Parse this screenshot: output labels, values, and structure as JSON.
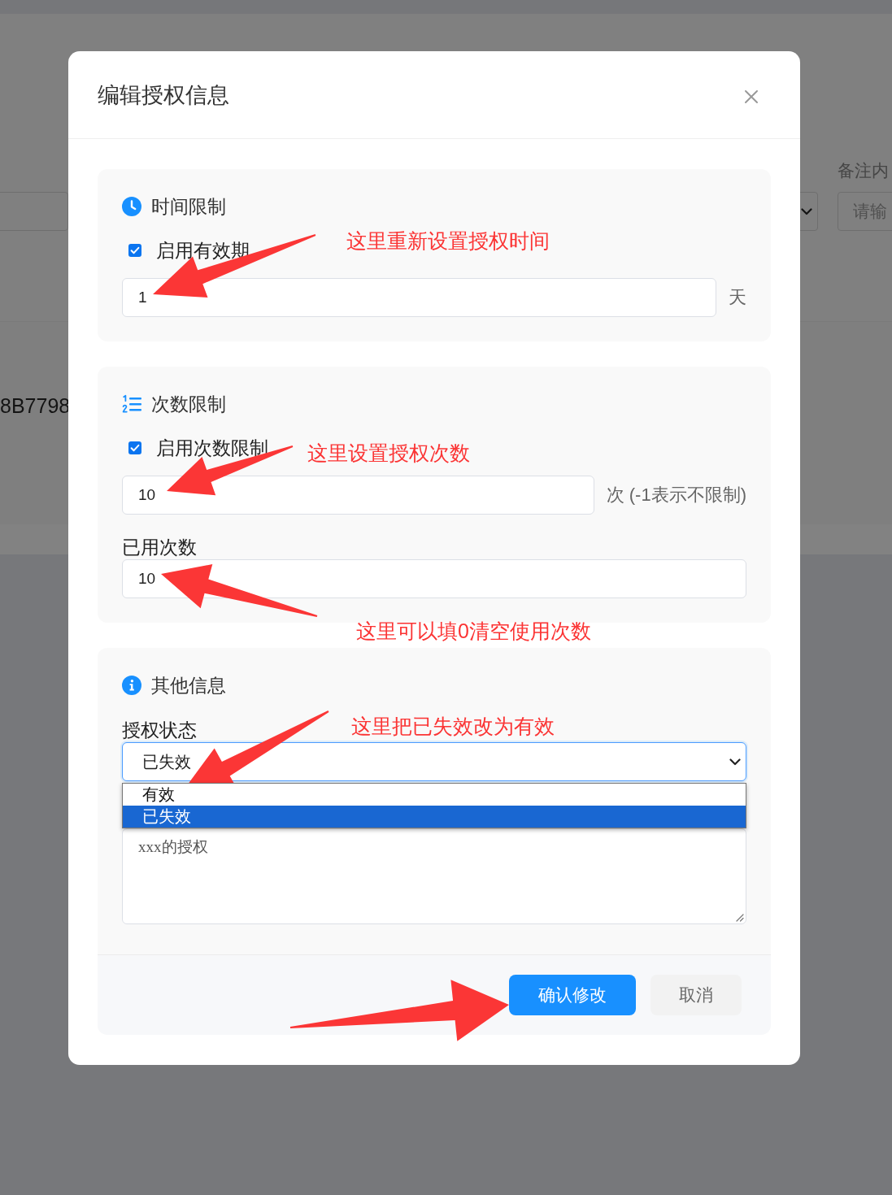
{
  "background_page": {
    "remark_filter": {
      "label": "备注内",
      "placeholder": "请输"
    },
    "table": {
      "rows": [
        {
          "column_1": "8B7798"
        }
      ]
    }
  },
  "dialog": {
    "title": "编辑授权信息",
    "sections": [
      {
        "kind": "time",
        "heading": "时间限制",
        "fields": [
          {
            "kind": "checkbox",
            "label": "启用有效期",
            "checked": true
          },
          {
            "kind": "input",
            "value": "1",
            "unit": "天"
          }
        ]
      },
      {
        "kind": "count",
        "heading": "次数限制",
        "fields": [
          {
            "kind": "checkbox",
            "label": "启用次数限制",
            "checked": true
          },
          {
            "kind": "input",
            "value": "10",
            "unit": "次 (-1表示不限制)"
          },
          {
            "kind": "input",
            "label": "已用次数",
            "value": "10"
          }
        ]
      },
      {
        "kind": "info",
        "heading": "其他信息",
        "fields": [
          {
            "kind": "select",
            "label": "授权状态",
            "value": "已失效",
            "expanded": true,
            "options": [
              {
                "label": "有效",
                "selected": false
              },
              {
                "label": "已失效",
                "selected": true
              }
            ]
          },
          {
            "kind": "textarea",
            "value": "xxx的授权"
          }
        ]
      }
    ],
    "buttons": [
      {
        "label": "确认修改",
        "kind": "primary"
      },
      {
        "label": "取消",
        "kind": "default"
      }
    ]
  },
  "annotations": [
    {
      "text": "这里重新设置授权时间"
    },
    {
      "text": "这里设置授权次数"
    },
    {
      "text": "这里可以填0清空使用次数"
    },
    {
      "text": "这里把已失效改为有效"
    }
  ]
}
